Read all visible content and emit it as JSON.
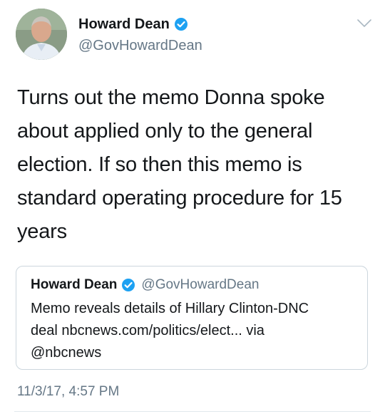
{
  "author": {
    "display_name": "Howard Dean",
    "handle": "@GovHowardDean",
    "verified": true
  },
  "tweet": {
    "lines": [
      "Turns out the memo Donna spoke",
      "about applied only to the general",
      "election. If so then this memo is",
      "standard operating procedure for 15",
      "years"
    ],
    "timestamp": "11/3/17, 4:57 PM"
  },
  "quoted_tweet": {
    "display_name": "Howard Dean",
    "handle": "@GovHowardDean",
    "verified": true,
    "lines": [
      "Memo reveals details of Hillary Clinton-DNC",
      "deal nbcnews.com/politics/elect... via",
      "@nbcnews"
    ]
  },
  "icons": {
    "verified": "verified-badge-icon",
    "menu": "chevron-down-icon"
  },
  "colors": {
    "text": "#14171a",
    "secondary": "#657786",
    "verified": "#1da1f2",
    "border": "#ccd6dd"
  }
}
